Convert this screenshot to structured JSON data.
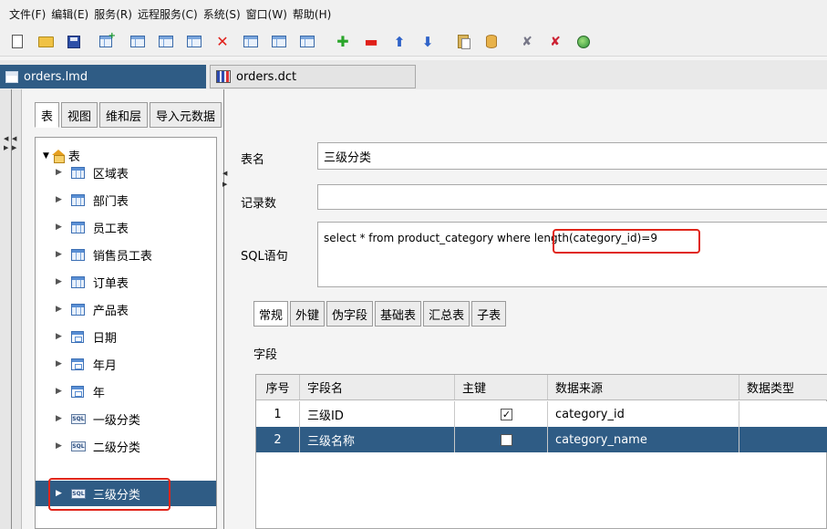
{
  "menu": [
    "文件(F)",
    "编辑(E)",
    "服务(R)",
    "远程服务(C)",
    "系统(S)",
    "窗口(W)",
    "帮助(H)"
  ],
  "toolbar_icons": [
    "new-file-icon",
    "open-folder-icon",
    "save-icon",
    "add-table-icon",
    "add-sql-table-icon",
    "edit-table-icon",
    "table-properties-icon",
    "delete-icon",
    "copy-table-icon",
    "insert-column-icon",
    "append-column-icon",
    "add-icon",
    "remove-icon",
    "move-up-icon",
    "move-down-icon",
    "paste-icon",
    "database-icon",
    "tool-icon",
    "debug-tool-icon",
    "globe-icon"
  ],
  "doc_tabs": {
    "active": "orders.lmd",
    "inactive": "orders.dct"
  },
  "left_tabs": [
    "表",
    "视图",
    "维和层",
    "导入元数据"
  ],
  "tree": {
    "root": "表",
    "items": [
      {
        "label": "区域表",
        "icon": "grid"
      },
      {
        "label": "部门表",
        "icon": "grid"
      },
      {
        "label": "员工表",
        "icon": "grid"
      },
      {
        "label": "销售员工表",
        "icon": "grid"
      },
      {
        "label": "订单表",
        "icon": "grid"
      },
      {
        "label": "产品表",
        "icon": "grid"
      },
      {
        "label": "日期",
        "icon": "calendar"
      },
      {
        "label": "年月",
        "icon": "calendar"
      },
      {
        "label": "年",
        "icon": "calendar"
      },
      {
        "label": "一级分类",
        "icon": "sql"
      },
      {
        "label": "二级分类",
        "icon": "sql"
      },
      {
        "label": "三级分类",
        "icon": "sql",
        "selected": true
      }
    ]
  },
  "form": {
    "table_name_label": "表名",
    "table_name_value": "三级分类",
    "record_count_label": "记录数",
    "record_count_value": "",
    "sql_label": "SQL语句",
    "sql_prefix": "select * from product_category where ",
    "sql_highlight": "length(category_id)=9"
  },
  "detail_tabs": [
    "常规",
    "外键",
    "伪字段",
    "基础表",
    "汇总表",
    "子表"
  ],
  "fields_label": "字段",
  "table": {
    "headers": [
      "序号",
      "字段名",
      "主键",
      "数据来源",
      "数据类型"
    ],
    "rows": [
      {
        "num": "1",
        "name": "三级ID",
        "pk": true,
        "source": "category_id",
        "type": ""
      },
      {
        "num": "2",
        "name": "三级名称",
        "pk": false,
        "source": "category_name",
        "type": ""
      }
    ]
  },
  "colors": {
    "selection": "#2f5c85",
    "highlight": "#e0251a"
  }
}
